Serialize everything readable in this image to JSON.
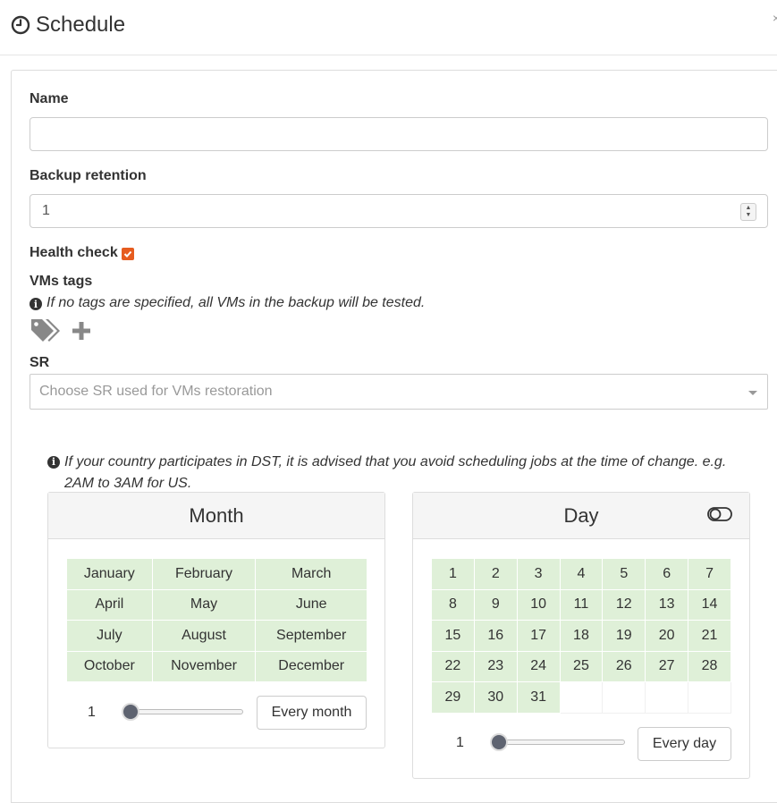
{
  "header": {
    "title": "Schedule",
    "close_label": "×"
  },
  "form": {
    "name_label": "Name",
    "name_value": "",
    "retention_label": "Backup retention",
    "retention_value": "1",
    "health_check_label": "Health check",
    "health_check_checked": true,
    "vms_tags_label": "VMs tags",
    "vms_tags_hint": "If no tags are specified, all VMs in the backup will be tested.",
    "sr_label": "SR",
    "sr_placeholder": "Choose SR used for VMs restoration"
  },
  "dst_hint": "If your country participates in DST, it is advised that you avoid scheduling jobs at the time of change. e.g. 2AM to 3AM for US.",
  "month_card": {
    "title": "Month",
    "months": [
      "January",
      "February",
      "March",
      "April",
      "May",
      "June",
      "July",
      "August",
      "September",
      "October",
      "November",
      "December"
    ],
    "slider_value": "1",
    "button_label": "Every month"
  },
  "day_card": {
    "title": "Day",
    "days": [
      "1",
      "2",
      "3",
      "4",
      "5",
      "6",
      "7",
      "8",
      "9",
      "10",
      "11",
      "12",
      "13",
      "14",
      "15",
      "16",
      "17",
      "18",
      "19",
      "20",
      "21",
      "22",
      "23",
      "24",
      "25",
      "26",
      "27",
      "28",
      "29",
      "30",
      "31"
    ],
    "slider_value": "1",
    "button_label": "Every day"
  },
  "colors": {
    "accent": "#e65c1f",
    "selected_cell": "#dff0d8",
    "slider_thumb": "#5e6370"
  },
  "icons": {
    "title": "clock-icon",
    "info": "info-circle-icon",
    "tags": "tags-icon",
    "add": "plus-icon",
    "toggle": "toggle-icon"
  }
}
